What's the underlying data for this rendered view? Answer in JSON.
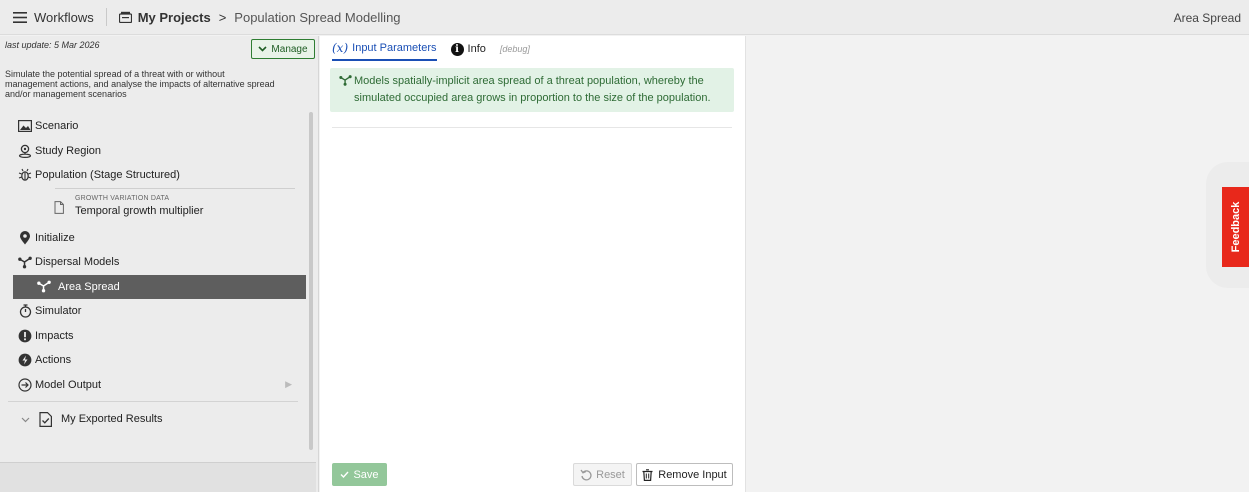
{
  "topbar": {
    "workflows_label": "Workflows",
    "breadcrumb": [
      "My Projects",
      "Population Spread Modelling"
    ],
    "breadcrumb_sep": ">",
    "right_label": "Area Spread"
  },
  "sidebar": {
    "last_update": "last update: 5 Mar 2026",
    "manage_label": "Manage",
    "description": "Simulate the potential spread of a threat with or without management actions, and analyse the impacts of alternative spread and/or management scenarios",
    "items": [
      {
        "label": "Scenario",
        "icon": "image-icon"
      },
      {
        "label": "Study Region",
        "icon": "location-pin-icon"
      },
      {
        "label": "Population (Stage Structured)",
        "icon": "bug-icon"
      },
      {
        "label": "Initialize",
        "icon": "map-marker-icon"
      },
      {
        "label": "Dispersal Models",
        "icon": "spread-icon"
      },
      {
        "label": "Area Spread",
        "icon": "spread-icon",
        "active": true
      },
      {
        "label": "Simulator",
        "icon": "stopwatch-icon"
      },
      {
        "label": "Impacts",
        "icon": "alert-icon"
      },
      {
        "label": "Actions",
        "icon": "lightning-icon"
      },
      {
        "label": "Model Output",
        "icon": "arrow-circle-icon"
      }
    ],
    "growth": {
      "caption": "GROWTH VARIATION DATA",
      "label": "Temporal growth multiplier"
    },
    "exported_label": "My Exported Results"
  },
  "main": {
    "tabs": {
      "input_symbol": "(x)",
      "input_label": "Input Parameters",
      "info_label": "Info",
      "debug_label": "[debug]"
    },
    "banner_text": "Models spatially-implicit area spread of a threat population, whereby the simulated occupied area grows in proportion to the size of the population.",
    "save_label": "Save",
    "reset_label": "Reset",
    "remove_label": "Remove Input"
  },
  "feedback_label": "Feedback",
  "colors": {
    "accent_blue": "#1a4fb5",
    "accent_green": "#2e7d32",
    "banner_bg": "#e2f2e6",
    "active_item_bg": "#5e5e5e",
    "feedback_red": "#e8281b"
  }
}
